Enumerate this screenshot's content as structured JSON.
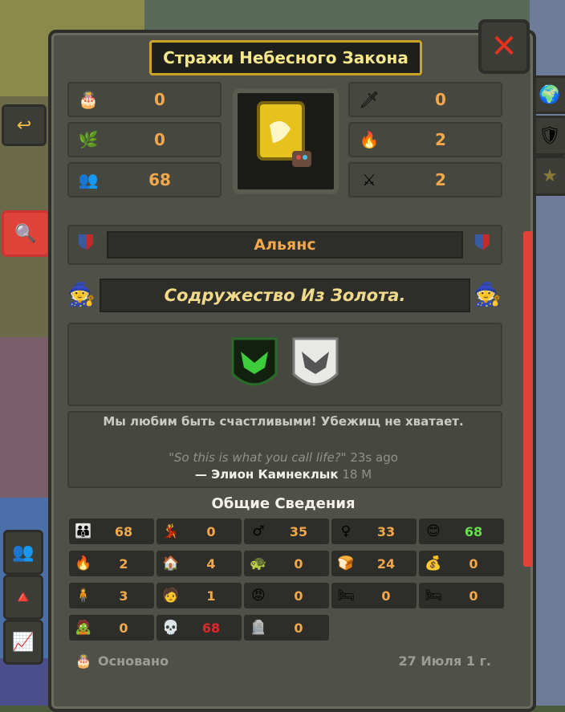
{
  "kingdom": {
    "title": "Стражи Небесного Закона"
  },
  "close": {
    "icon": "✕"
  },
  "top_stats_left": [
    {
      "icon": "cake-icon",
      "glyph": "🎂",
      "value": "0"
    },
    {
      "icon": "laurel-icon",
      "glyph": "🌿",
      "value": "0"
    },
    {
      "icon": "population-icon",
      "glyph": "👥",
      "value": "68"
    }
  ],
  "top_stats_right": [
    {
      "icon": "sword-icon",
      "glyph": "🗡",
      "value": "0"
    },
    {
      "icon": "fire-icon",
      "glyph": "🔥",
      "value": "2"
    },
    {
      "icon": "army-icon",
      "glyph": "⚔",
      "value": "2"
    }
  ],
  "alliance": {
    "label": "Альянс"
  },
  "culture": {
    "label": "Содружество Из Золота."
  },
  "motto": "Мы любим быть счастливыми! Убежищ не хватает.",
  "quote": {
    "text": "\"So this is what you call life?\"",
    "ago": "23s ago"
  },
  "author": {
    "name": "— Элион Камнеклык",
    "age": "18 M"
  },
  "section_title": "Общие Сведения",
  "stats": [
    {
      "icon": "people-icon",
      "glyph": "👪",
      "value": "68",
      "color": "#f2a84a"
    },
    {
      "icon": "dancer-icon",
      "glyph": "💃",
      "value": "0",
      "color": "#f2a84a"
    },
    {
      "icon": "male-icon",
      "glyph": "♂",
      "value": "35",
      "color": "#f2a84a"
    },
    {
      "icon": "female-icon",
      "glyph": "♀",
      "value": "33",
      "color": "#f2a84a"
    },
    {
      "icon": "happy-icon",
      "glyph": "😊",
      "value": "68",
      "color": "#63e04a"
    },
    {
      "icon": "fire-icon",
      "glyph": "🔥",
      "value": "2",
      "color": "#f2a84a"
    },
    {
      "icon": "house-icon",
      "glyph": "🏠",
      "value": "4",
      "color": "#f2a84a"
    },
    {
      "icon": "turtle-icon",
      "glyph": "🐢",
      "value": "0",
      "color": "#f2a84a"
    },
    {
      "icon": "bread-icon",
      "glyph": "🍞",
      "value": "24",
      "color": "#f2a84a"
    },
    {
      "icon": "gold-icon",
      "glyph": "💰",
      "value": "0",
      "color": "#f2a84a"
    },
    {
      "icon": "worker-icon",
      "glyph": "🧍",
      "value": "3",
      "color": "#f2a84a"
    },
    {
      "icon": "farmer-icon",
      "glyph": "🧑",
      "value": "1",
      "color": "#f2a84a"
    },
    {
      "icon": "angry-icon",
      "glyph": "😡",
      "value": "0",
      "color": "#f2a84a"
    },
    {
      "icon": "bed-icon",
      "glyph": "🛏",
      "value": "0",
      "color": "#f2a84a"
    },
    {
      "icon": "bed2-icon",
      "glyph": "🛏",
      "value": "0",
      "color": "#f2a84a"
    },
    {
      "icon": "zombie-icon",
      "glyph": "🧟",
      "value": "0",
      "color": "#f2a84a"
    },
    {
      "icon": "dead-icon",
      "glyph": "💀",
      "value": "68",
      "color": "#e0282a"
    },
    {
      "icon": "grave-icon",
      "glyph": "🪦",
      "value": "0",
      "color": "#f2a84a"
    }
  ],
  "founded": {
    "label": "Основано",
    "date": "27 Июля 1 г."
  },
  "colors": {
    "accent": "#f2a84a",
    "title_border": "#c9a426",
    "scrollbar": "#e0433a"
  }
}
